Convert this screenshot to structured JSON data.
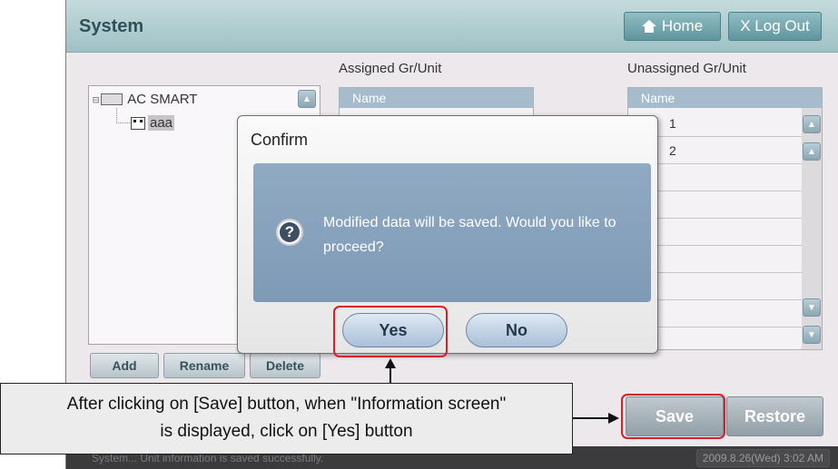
{
  "header": {
    "title": "System",
    "home_label": "Home",
    "logout_label": "X Log Out"
  },
  "tree": {
    "root_label": "AC SMART",
    "child_label": "aaa"
  },
  "assigned": {
    "label": "Assigned Gr/Unit",
    "col_name": "Name"
  },
  "unassigned": {
    "label": "Unassigned Gr/Unit",
    "col_name": "Name",
    "rows": [
      "1",
      "2"
    ]
  },
  "tree_buttons": {
    "add": "Add",
    "rename": "Rename",
    "delete": "Delete"
  },
  "actions": {
    "save": "Save",
    "restore": "Restore"
  },
  "status": {
    "message": "System... Unit information is saved successfully.",
    "datetime": "2009.8.26(Wed)  3:02 AM"
  },
  "dialog": {
    "title": "Confirm",
    "message": "Modified data will be saved.  Would you like to proceed?",
    "yes": "Yes",
    "no": "No"
  },
  "annotation": {
    "line1": "After clicking on [Save] button, when \"Information screen\"",
    "line2": "is displayed, click on [Yes] button"
  },
  "colors": {
    "highlight": "#d8202a",
    "titlebar": "#9ec1c5",
    "dialog_body": "#85a0bb"
  }
}
